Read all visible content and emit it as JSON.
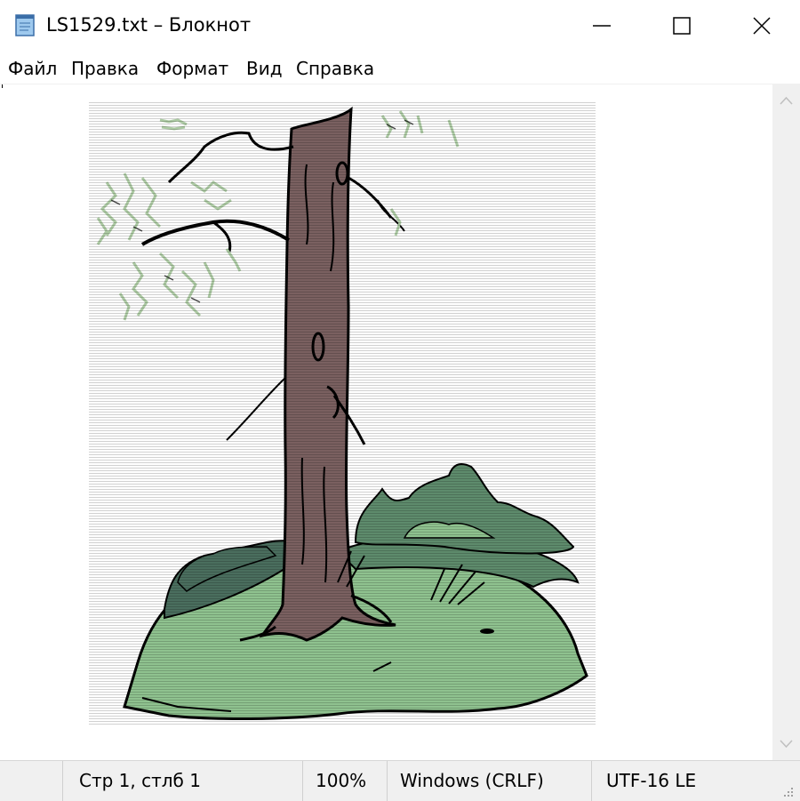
{
  "window": {
    "title": "LS1529.txt – Блокнот"
  },
  "menu": [
    "Файл",
    "Правка",
    "Формат",
    "Вид",
    "Справка"
  ],
  "status": {
    "position": "Стр 1, стлб 1",
    "zoom": "100%",
    "line_endings": "Windows (CRLF)",
    "encoding": "UTF-16 LE"
  },
  "icons": {
    "app": "notepad-icon",
    "minimize": "minimize-icon",
    "maximize": "maximize-icon",
    "close": "close-icon",
    "scroll_up": "scroll-up-arrow-icon",
    "scroll_down": "scroll-down-arrow-icon",
    "grip": "resize-grip-icon"
  },
  "colors": {
    "trunk": "#7a6060",
    "grass_light": "#8fc28f",
    "grass_mid": "#5e8b6c",
    "bush_dark": "#4a6e5e",
    "leaves": "#a9c9a0",
    "outline": "#000000"
  }
}
